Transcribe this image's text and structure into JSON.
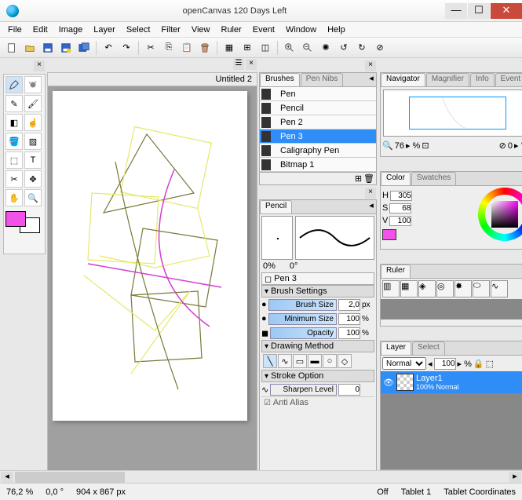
{
  "titlebar": {
    "title": "openCanvas 120 Days Left"
  },
  "menu": [
    "File",
    "Edit",
    "Image",
    "Layer",
    "Select",
    "Filter",
    "View",
    "Ruler",
    "Event",
    "Window",
    "Help"
  ],
  "document": {
    "title": "Untitled 2"
  },
  "brushes_panel": {
    "tabs": [
      "Brushes",
      "Pen Nibs"
    ],
    "items": [
      "Pen",
      "Pencil",
      "Pen 2",
      "Pen 3",
      "Caligraphy Pen",
      "Bitmap 1"
    ],
    "selected": "Pen 3"
  },
  "preview_panel": {
    "tab": "Pencil",
    "min_pct": "0%",
    "angle": "0°",
    "tool_label": "Pen 3"
  },
  "brush_settings": {
    "header": "Brush Settings",
    "rows": [
      {
        "label": "Brush Size",
        "value": "2,0",
        "unit": "px"
      },
      {
        "label": "Minimum Size",
        "value": "100",
        "unit": "%"
      },
      {
        "label": "Opacity",
        "value": "100",
        "unit": "%"
      }
    ],
    "method_header": "Drawing Method",
    "stroke_header": "Stroke Option",
    "sharpen": {
      "label": "Sharpen Level",
      "value": "0"
    },
    "aa": "Anti Alias"
  },
  "navigator": {
    "tabs": [
      "Navigator",
      "Magnifier",
      "Info",
      "Event"
    ],
    "zoom": "76",
    "angle": "0"
  },
  "color": {
    "tabs": [
      "Color",
      "Swatches"
    ],
    "h": "305",
    "s": "68",
    "v": "100",
    "swatch": "#f352e8"
  },
  "ruler": {
    "tab": "Ruler"
  },
  "layer": {
    "tabs": [
      "Layer",
      "Select"
    ],
    "mode": "Normal",
    "opacity": "100",
    "name": "Layer1",
    "blend": "100% Normal"
  },
  "status": {
    "zoom": "76,2 %",
    "coords": "0,0 °",
    "dims": "904 x 867 px",
    "off": "Off",
    "tablet": "Tablet 1",
    "tc": "Tablet Coordinates"
  },
  "tool_swatch": "#f352e8"
}
